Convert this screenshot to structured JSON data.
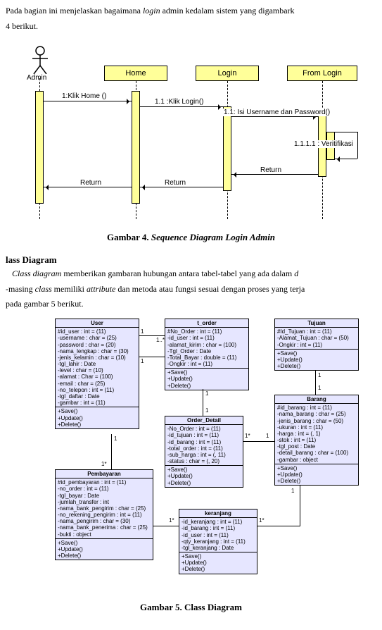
{
  "intro": {
    "line1_before": "Pada bagian ini menjelaskan bagaimana ",
    "line1_italic": "login",
    "line1_after": " admin kedalam sistem yang digambark",
    "line2": "4 berikut."
  },
  "seq": {
    "actor": "Admin",
    "home": "Home",
    "login": "Login",
    "form": "From Login",
    "msg1": "1:Klik Home ()",
    "msg2": "1.1 :Klik Login()",
    "msg3": "1.1: Isi Username dan Password()",
    "msg4": "1.1.1.1 : Veritifikasi",
    "ret": "Return"
  },
  "caption1_prefix": "Gambar 4. ",
  "caption1_italic": "Sequence Diagram Login Admin",
  "sec2": {
    "head": "lass Diagram",
    "p1a": "Class diagram",
    "p1b": " memberikan gambaran hubungan antara tabel-tabel yang ada dalam ",
    "p1c": "d",
    "p2a": "-masing ",
    "p2b": "class",
    "p2c": " memiliki ",
    "p2d": "attribute",
    "p2e": " dan metoda atau fungsi sesuai dengan proses yang terja",
    "p3": " pada gambar 5 berikut."
  },
  "classes": {
    "user": {
      "title": "User",
      "attrs": "#id_user : int = (11)\n-username : char = (25)\n-password : char = (20)\n-nama_lengkap : char = (30)\n-jenis_kelamin : char = (10)\n-tgl_lahir : Date\n-level : char = (10)\n-alamat : Char = (100)\n-email : char = (25)\n-no_telepon : int = (11)\n-tgl_daftar : Date\n-gambar : int = (11)",
      "ops": "+Save()\n+Update()\n+Delete()"
    },
    "torder": {
      "title": "t_order",
      "attrs": "#No_Order : int = (11)\n-id_user : int = (11)\n-alamat_kirim : char = (100)\n-Tgl_Order : Date\n-Total_Bayar : double = (11)\n-Ongkir : int = (11)",
      "ops": "+Save()\n+Update()\n+Delete()"
    },
    "tujuan": {
      "title": "Tujuan",
      "attrs": "#Id_Tujuan : int = (11)\n-Alamat_Tujuan : char = (50)\n-Ongkir : int = (11)",
      "ops": "+Save()\n+Update()\n+Delete()"
    },
    "orderdetail": {
      "title": "Order_Detail",
      "attrs": "-No_Order : int = (11)\n-id_tujuan : int = (11)\n-id_barang : int = (11)\n-total_order : int = (11)\n-sub_harga : int = (, 11)\n-status : char = (, 20)",
      "ops": "+Save()\n+Update()\n+Delete()"
    },
    "barang": {
      "title": "Barang",
      "attrs": "#id_barang : int = (11)\n-nama_barang : char = (25)\n-jenis_barang : char = (50)\n-ukuran : int = (11)\n-harga : int = (, 1)\n-stok : int = (11)\n-tgl_post : Date\n-detail_barang : char = (100)\n-gambar : object",
      "ops": "+Save()\n+Update()\n+Delete()"
    },
    "keranjang": {
      "title": "keranjang",
      "attrs": "-id_keranjang : int = (11)\n-id_barang : int = (11)\n-id_user : int = (11)\n-qty_keranjang : int = (11)\n-tgl_keranjang : Date",
      "ops": "+Save()\n+Update()\n+Delete()"
    },
    "pembayaran": {
      "title": "Pembayaran",
      "attrs": "#id_pembayaran : int = (11)\n-no_order : int = (11)\n-tgl_bayar : Date\n-jumlah_transfer : int\n-nama_bank_pengirim : char = (25)\n-no_rekening_pengirim : int = (11)\n-nama_pengirim : char = (30)\n-nama_bank_penerima : char = (25)\n-bukti : object",
      "ops": "+Save()\n+Update()\n+Delete()"
    }
  },
  "mult": {
    "one": "1",
    "many": "1..*",
    "oneToMany": "1*"
  },
  "caption2": "Gambar 5. Class Diagram"
}
